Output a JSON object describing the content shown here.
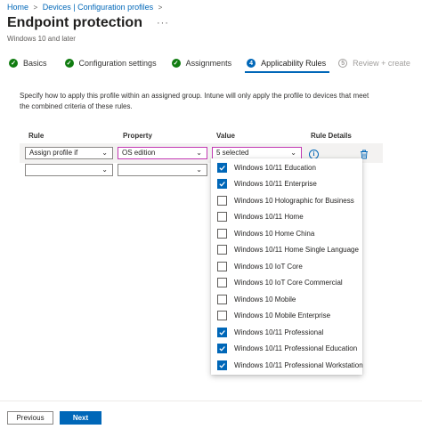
{
  "breadcrumb": {
    "items": [
      "Home",
      "Devices | Configuration profiles"
    ]
  },
  "header": {
    "title": "Endpoint protection",
    "more": "···",
    "subtitle": "Windows 10 and later"
  },
  "steps": [
    {
      "label": "Basics",
      "state": "done",
      "marker": "✓"
    },
    {
      "label": "Configuration settings",
      "state": "done",
      "marker": "✓"
    },
    {
      "label": "Assignments",
      "state": "done",
      "marker": "✓"
    },
    {
      "label": "Applicability Rules",
      "state": "active",
      "marker": "4"
    },
    {
      "label": "Review + create",
      "state": "pending",
      "marker": "5"
    }
  ],
  "description": "Specify how to apply this profile within an assigned group. Intune will only apply the profile to devices that meet the combined criteria of these rules.",
  "table": {
    "headers": {
      "rule": "Rule",
      "property": "Property",
      "value": "Value",
      "details": "Rule Details"
    },
    "rows": [
      {
        "rule": "Assign profile if",
        "property": "OS edition",
        "value": "5 selected"
      },
      {
        "rule": "",
        "property": "",
        "value": ""
      }
    ]
  },
  "dropdown": {
    "options": [
      {
        "label": "Windows 10/11 Education",
        "checked": true
      },
      {
        "label": "Windows 10/11 Enterprise",
        "checked": true
      },
      {
        "label": "Windows 10 Holographic for Business",
        "checked": false
      },
      {
        "label": "Windows 10/11 Home",
        "checked": false
      },
      {
        "label": "Windows 10 Home China",
        "checked": false
      },
      {
        "label": "Windows 10/11 Home Single Language",
        "checked": false
      },
      {
        "label": "Windows 10 IoT Core",
        "checked": false
      },
      {
        "label": "Windows 10 IoT Core Commercial",
        "checked": false
      },
      {
        "label": "Windows 10 Mobile",
        "checked": false
      },
      {
        "label": "Windows 10 Mobile Enterprise",
        "checked": false
      },
      {
        "label": "Windows 10/11 Professional",
        "checked": true
      },
      {
        "label": "Windows 10/11 Professional Education",
        "checked": true
      },
      {
        "label": "Windows 10/11 Professional Workstation",
        "checked": true
      }
    ]
  },
  "footer": {
    "previous": "Previous",
    "next": "Next"
  },
  "colors": {
    "accent": "#0067b8",
    "success": "#107c10",
    "focus": "#c239b3"
  },
  "icons": {
    "info": "info-icon",
    "delete": "trash-icon",
    "chevron": "chevron-down-icon",
    "chevron_right": "chevron-right-icon"
  }
}
